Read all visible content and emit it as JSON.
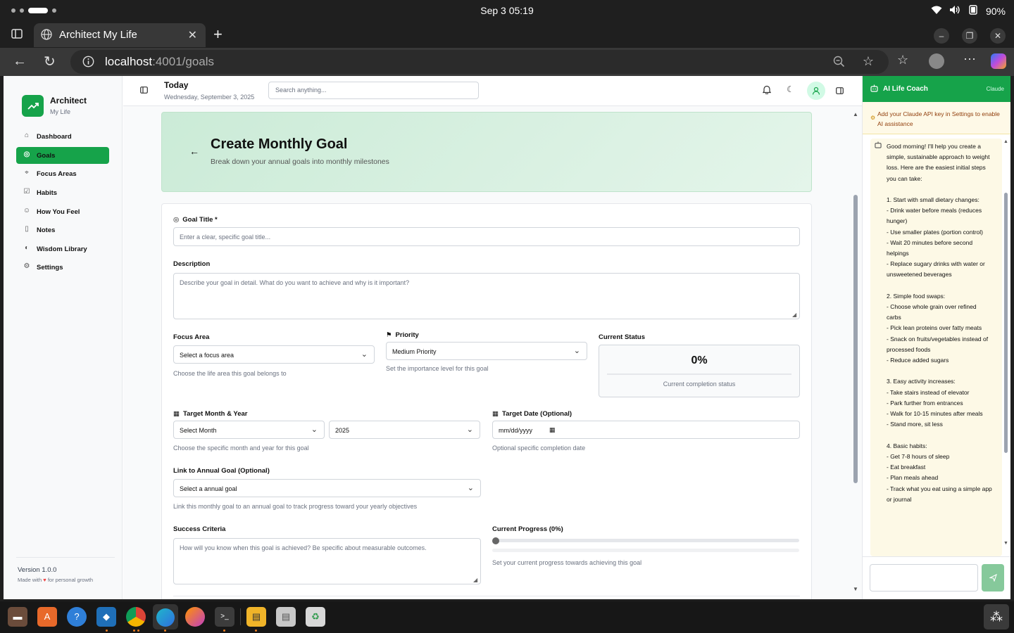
{
  "system": {
    "clock": "Sep 3  05:19",
    "battery": "90%"
  },
  "browser": {
    "tab_title": "Architect My Life",
    "url_host": "localhost",
    "url_rest": ":4001/goals"
  },
  "sidebar": {
    "brand": "Architect",
    "brand_sub": "My Life",
    "items": [
      {
        "label": "Dashboard",
        "icon": "home-icon"
      },
      {
        "label": "Goals",
        "icon": "target-icon"
      },
      {
        "label": "Focus Areas",
        "icon": "focus-icon"
      },
      {
        "label": "Habits",
        "icon": "checklist-icon"
      },
      {
        "label": "How You Feel",
        "icon": "smile-icon"
      },
      {
        "label": "Notes",
        "icon": "book-icon"
      },
      {
        "label": "Wisdom Library",
        "icon": "library-icon"
      },
      {
        "label": "Settings",
        "icon": "gear-icon"
      }
    ],
    "version": "Version 1.0.0",
    "made_with_prefix": "Made with",
    "made_with_suffix": "for personal growth"
  },
  "header": {
    "title": "Today",
    "date": "Wednesday, September 3, 2025",
    "search_placeholder": "Search anything..."
  },
  "banner": {
    "title": "Create Monthly Goal",
    "subtitle": "Break down your annual goals into monthly milestones"
  },
  "form": {
    "goal_title_label": "Goal Title *",
    "goal_title_placeholder": "Enter a clear, specific goal title...",
    "description_label": "Description",
    "description_placeholder": "Describe your goal in detail. What do you want to achieve and why is it important?",
    "focus_area_label": "Focus Area",
    "focus_area_value": "Select a focus area",
    "focus_area_hint": "Choose the life area this goal belongs to",
    "priority_label": "Priority",
    "priority_value": "Medium Priority",
    "priority_hint": "Set the importance level for this goal",
    "status_label": "Current Status",
    "status_value": "0%",
    "status_progress": 0,
    "status_caption": "Current completion status",
    "target_label": "Target Month & Year",
    "month_value": "Select Month",
    "year_value": "2025",
    "target_hint": "Choose the specific month and year for this goal",
    "target_date_label": "Target Date (Optional)",
    "target_date_placeholder": "mm/dd/yyyy",
    "target_date_hint": "Optional specific completion date",
    "annual_label": "Link to Annual Goal (Optional)",
    "annual_value": "Select a annual goal",
    "annual_hint": "Link this monthly goal to an annual goal to track progress toward your yearly objectives",
    "success_label": "Success Criteria",
    "success_placeholder": "How will you know when this goal is achieved? Be specific about measurable outcomes.",
    "progress_label": "Current Progress (0%)",
    "progress_value": 0,
    "progress_hint": "Set your current progress towards achieving this goal"
  },
  "coach": {
    "title": "AI Life Coach",
    "model": "Claude",
    "warning": "Add your Claude API key in Settings to enable AI assistance",
    "message": "Good morning! I'll help you create a simple, sustainable approach to weight loss. Here are the easiest initial steps you can take:\n\n1. Start with small dietary changes:\n- Drink water before meals (reduces hunger)\n- Use smaller plates (portion control)\n- Wait 20 minutes before second helpings\n- Replace sugary drinks with water or unsweetened beverages\n\n2. Simple food swaps:\n- Choose whole grain over refined carbs\n- Pick lean proteins over fatty meats\n- Snack on fruits/vegetables instead of processed foods\n- Reduce added sugars\n\n3. Easy activity increases:\n- Take stairs instead of elevator\n- Park further from entrances\n- Walk for 10-15 minutes after meals\n- Stand more, sit less\n\n4. Basic habits:\n- Get 7-8 hours of sleep\n- Eat breakfast\n- Plan meals ahead\n- Track what you eat using a simple app or journal"
  },
  "colors": {
    "accent": "#16a34a",
    "banner_bg": "#d4efdf",
    "warning_bg": "#fef9e7"
  }
}
